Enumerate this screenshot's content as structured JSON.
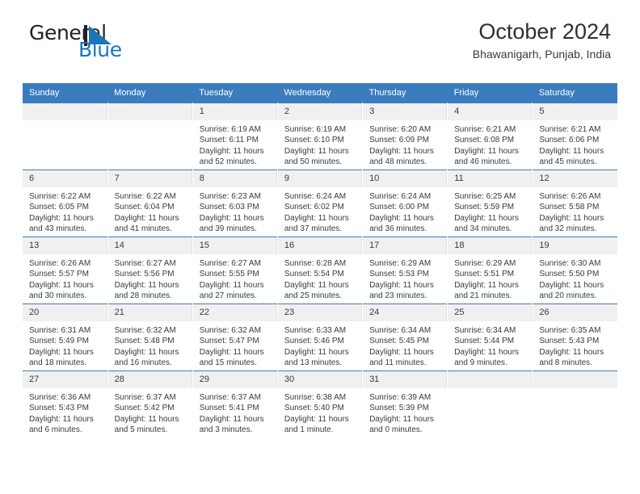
{
  "logo": {
    "word_general": "General",
    "word_blue": "Blue",
    "sail_icon": "sail-triangle-icon",
    "colors": {
      "dark": "#231f20",
      "blue": "#1b75bb"
    }
  },
  "header": {
    "title": "October 2024",
    "subtitle": "Bhawanigarh, Punjab, India"
  },
  "theme": {
    "header_blue": "#3b7cbf",
    "daynum_band": "#f0f0f0",
    "text": "#3a3a3a"
  },
  "weekdays": [
    "Sunday",
    "Monday",
    "Tuesday",
    "Wednesday",
    "Thursday",
    "Friday",
    "Saturday"
  ],
  "weeks": [
    [
      {
        "day": "",
        "empty": true
      },
      {
        "day": "",
        "empty": true
      },
      {
        "day": "1",
        "sunrise": "Sunrise: 6:19 AM",
        "sunset": "Sunset: 6:11 PM",
        "daylight": "Daylight: 11 hours and 52 minutes."
      },
      {
        "day": "2",
        "sunrise": "Sunrise: 6:19 AM",
        "sunset": "Sunset: 6:10 PM",
        "daylight": "Daylight: 11 hours and 50 minutes."
      },
      {
        "day": "3",
        "sunrise": "Sunrise: 6:20 AM",
        "sunset": "Sunset: 6:09 PM",
        "daylight": "Daylight: 11 hours and 48 minutes."
      },
      {
        "day": "4",
        "sunrise": "Sunrise: 6:21 AM",
        "sunset": "Sunset: 6:08 PM",
        "daylight": "Daylight: 11 hours and 46 minutes."
      },
      {
        "day": "5",
        "sunrise": "Sunrise: 6:21 AM",
        "sunset": "Sunset: 6:06 PM",
        "daylight": "Daylight: 11 hours and 45 minutes."
      }
    ],
    [
      {
        "day": "6",
        "sunrise": "Sunrise: 6:22 AM",
        "sunset": "Sunset: 6:05 PM",
        "daylight": "Daylight: 11 hours and 43 minutes."
      },
      {
        "day": "7",
        "sunrise": "Sunrise: 6:22 AM",
        "sunset": "Sunset: 6:04 PM",
        "daylight": "Daylight: 11 hours and 41 minutes."
      },
      {
        "day": "8",
        "sunrise": "Sunrise: 6:23 AM",
        "sunset": "Sunset: 6:03 PM",
        "daylight": "Daylight: 11 hours and 39 minutes."
      },
      {
        "day": "9",
        "sunrise": "Sunrise: 6:24 AM",
        "sunset": "Sunset: 6:02 PM",
        "daylight": "Daylight: 11 hours and 37 minutes."
      },
      {
        "day": "10",
        "sunrise": "Sunrise: 6:24 AM",
        "sunset": "Sunset: 6:00 PM",
        "daylight": "Daylight: 11 hours and 36 minutes."
      },
      {
        "day": "11",
        "sunrise": "Sunrise: 6:25 AM",
        "sunset": "Sunset: 5:59 PM",
        "daylight": "Daylight: 11 hours and 34 minutes."
      },
      {
        "day": "12",
        "sunrise": "Sunrise: 6:26 AM",
        "sunset": "Sunset: 5:58 PM",
        "daylight": "Daylight: 11 hours and 32 minutes."
      }
    ],
    [
      {
        "day": "13",
        "sunrise": "Sunrise: 6:26 AM",
        "sunset": "Sunset: 5:57 PM",
        "daylight": "Daylight: 11 hours and 30 minutes."
      },
      {
        "day": "14",
        "sunrise": "Sunrise: 6:27 AM",
        "sunset": "Sunset: 5:56 PM",
        "daylight": "Daylight: 11 hours and 28 minutes."
      },
      {
        "day": "15",
        "sunrise": "Sunrise: 6:27 AM",
        "sunset": "Sunset: 5:55 PM",
        "daylight": "Daylight: 11 hours and 27 minutes."
      },
      {
        "day": "16",
        "sunrise": "Sunrise: 6:28 AM",
        "sunset": "Sunset: 5:54 PM",
        "daylight": "Daylight: 11 hours and 25 minutes."
      },
      {
        "day": "17",
        "sunrise": "Sunrise: 6:29 AM",
        "sunset": "Sunset: 5:53 PM",
        "daylight": "Daylight: 11 hours and 23 minutes."
      },
      {
        "day": "18",
        "sunrise": "Sunrise: 6:29 AM",
        "sunset": "Sunset: 5:51 PM",
        "daylight": "Daylight: 11 hours and 21 minutes."
      },
      {
        "day": "19",
        "sunrise": "Sunrise: 6:30 AM",
        "sunset": "Sunset: 5:50 PM",
        "daylight": "Daylight: 11 hours and 20 minutes."
      }
    ],
    [
      {
        "day": "20",
        "sunrise": "Sunrise: 6:31 AM",
        "sunset": "Sunset: 5:49 PM",
        "daylight": "Daylight: 11 hours and 18 minutes."
      },
      {
        "day": "21",
        "sunrise": "Sunrise: 6:32 AM",
        "sunset": "Sunset: 5:48 PM",
        "daylight": "Daylight: 11 hours and 16 minutes."
      },
      {
        "day": "22",
        "sunrise": "Sunrise: 6:32 AM",
        "sunset": "Sunset: 5:47 PM",
        "daylight": "Daylight: 11 hours and 15 minutes."
      },
      {
        "day": "23",
        "sunrise": "Sunrise: 6:33 AM",
        "sunset": "Sunset: 5:46 PM",
        "daylight": "Daylight: 11 hours and 13 minutes."
      },
      {
        "day": "24",
        "sunrise": "Sunrise: 6:34 AM",
        "sunset": "Sunset: 5:45 PM",
        "daylight": "Daylight: 11 hours and 11 minutes."
      },
      {
        "day": "25",
        "sunrise": "Sunrise: 6:34 AM",
        "sunset": "Sunset: 5:44 PM",
        "daylight": "Daylight: 11 hours and 9 minutes."
      },
      {
        "day": "26",
        "sunrise": "Sunrise: 6:35 AM",
        "sunset": "Sunset: 5:43 PM",
        "daylight": "Daylight: 11 hours and 8 minutes."
      }
    ],
    [
      {
        "day": "27",
        "sunrise": "Sunrise: 6:36 AM",
        "sunset": "Sunset: 5:43 PM",
        "daylight": "Daylight: 11 hours and 6 minutes."
      },
      {
        "day": "28",
        "sunrise": "Sunrise: 6:37 AM",
        "sunset": "Sunset: 5:42 PM",
        "daylight": "Daylight: 11 hours and 5 minutes."
      },
      {
        "day": "29",
        "sunrise": "Sunrise: 6:37 AM",
        "sunset": "Sunset: 5:41 PM",
        "daylight": "Daylight: 11 hours and 3 minutes."
      },
      {
        "day": "30",
        "sunrise": "Sunrise: 6:38 AM",
        "sunset": "Sunset: 5:40 PM",
        "daylight": "Daylight: 11 hours and 1 minute."
      },
      {
        "day": "31",
        "sunrise": "Sunrise: 6:39 AM",
        "sunset": "Sunset: 5:39 PM",
        "daylight": "Daylight: 11 hours and 0 minutes."
      },
      {
        "day": "",
        "empty": true
      },
      {
        "day": "",
        "empty": true
      }
    ]
  ]
}
